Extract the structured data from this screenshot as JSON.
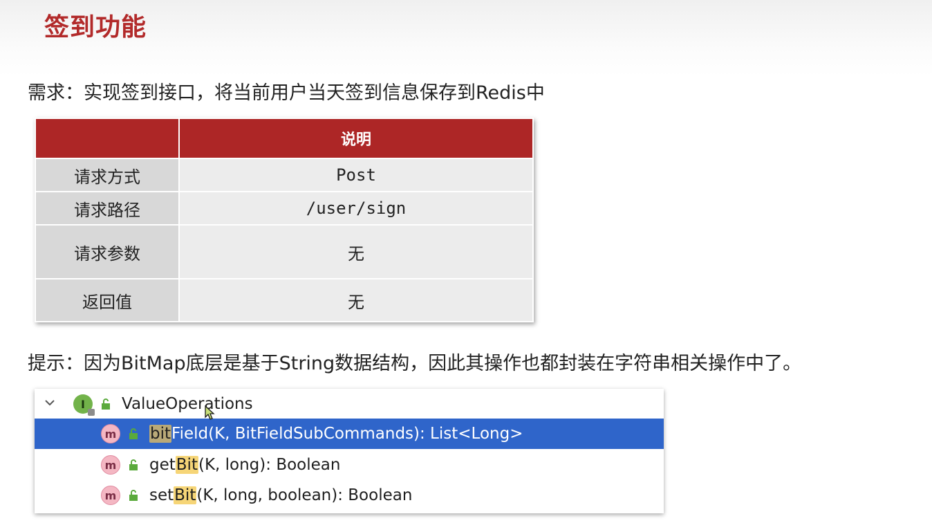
{
  "title": "签到功能",
  "requirement": "需求：实现签到接口，将当前用户当天签到信息保存到Redis中",
  "api_table": {
    "header_label": "",
    "header_value": "说明",
    "rows": [
      {
        "key": "请求方式",
        "value": "Post"
      },
      {
        "key": "请求路径",
        "value": "/user/sign"
      },
      {
        "key": "请求参数",
        "value": "无"
      },
      {
        "key": "返回值",
        "value": "无"
      }
    ]
  },
  "hint": "提示：因为BitMap底层是基于String数据结构，因此其操作也都封装在字符串相关操作中了。",
  "ide": {
    "interface_badge": "I",
    "interface_name": "ValueOperations",
    "methods": [
      {
        "badge": "m",
        "prefix": "",
        "highlight": "bit",
        "rest": "Field(K, BitFieldSubCommands): List<Long>",
        "selected": true
      },
      {
        "badge": "m",
        "prefix": "get",
        "highlight": "Bit",
        "rest": "(K, long): Boolean",
        "selected": false
      },
      {
        "badge": "m",
        "prefix": "set",
        "highlight": "Bit",
        "rest": "(K, long, boolean): Boolean",
        "selected": false
      }
    ],
    "icons": {
      "expand": "chevron-down-icon",
      "interface": "interface-icon",
      "method": "method-icon",
      "access": "unlock-icon"
    }
  },
  "colors": {
    "title": "#b22a2a",
    "table_header": "#ad2626",
    "selection": "#2f65ca",
    "match_highlight": "#f6d577"
  }
}
